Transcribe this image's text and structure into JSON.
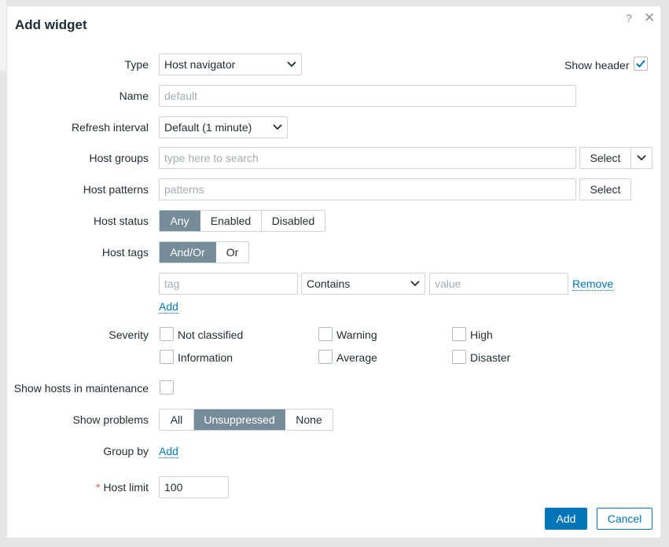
{
  "dialog": {
    "title": "Add widget",
    "help_icon": "question-mark-icon",
    "close_icon": "close-icon"
  },
  "form": {
    "type": {
      "label": "Type",
      "value": "Host navigator"
    },
    "show_header": {
      "label": "Show header",
      "checked": true
    },
    "name": {
      "label": "Name",
      "placeholder": "default",
      "value": ""
    },
    "refresh_interval": {
      "label": "Refresh interval",
      "value": "Default (1 minute)"
    },
    "host_groups": {
      "label": "Host groups",
      "placeholder": "type here to search",
      "select_label": "Select"
    },
    "host_patterns": {
      "label": "Host patterns",
      "placeholder": "patterns",
      "select_label": "Select"
    },
    "host_status": {
      "label": "Host status",
      "options": [
        "Any",
        "Enabled",
        "Disabled"
      ],
      "selected": "Any"
    },
    "host_tags": {
      "label": "Host tags",
      "options": [
        "And/Or",
        "Or"
      ],
      "selected": "And/Or",
      "row": {
        "tag_placeholder": "tag",
        "operator": "Contains",
        "value_placeholder": "value",
        "remove_label": "Remove"
      },
      "add_label": "Add"
    },
    "severity": {
      "label": "Severity",
      "items": [
        "Not classified",
        "Warning",
        "High",
        "Information",
        "Average",
        "Disaster"
      ]
    },
    "show_maintenance": {
      "label": "Show hosts in maintenance",
      "checked": false
    },
    "show_problems": {
      "label": "Show problems",
      "options": [
        "All",
        "Unsuppressed",
        "None"
      ],
      "selected": "Unsuppressed"
    },
    "group_by": {
      "label": "Group by",
      "add_label": "Add"
    },
    "host_limit": {
      "label": "Host limit",
      "required_mark": "*",
      "value": "100"
    }
  },
  "footer": {
    "add_label": "Add",
    "cancel_label": "Cancel"
  },
  "colors": {
    "accent": "#0275b8",
    "segment_active": "#768d99",
    "required": "#e45959"
  }
}
